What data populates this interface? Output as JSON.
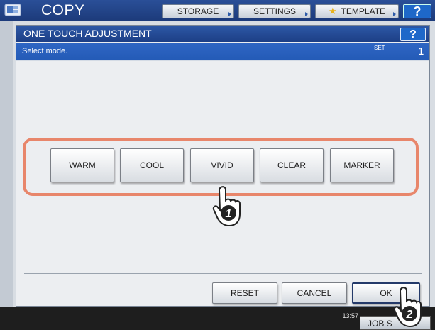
{
  "app": {
    "title": "COPY"
  },
  "top_tabs": [
    {
      "label": "STORAGE"
    },
    {
      "label": "SETTINGS"
    },
    {
      "label": "TEMPLATE"
    }
  ],
  "top_help": "?",
  "dialog": {
    "title": "ONE TOUCH ADJUSTMENT",
    "help": "?",
    "message": "Select mode.",
    "set_label": "SET",
    "set_count": "1",
    "modes": [
      "WARM",
      "COOL",
      "VIVID",
      "CLEAR",
      "MARKER"
    ],
    "buttons": {
      "reset": "RESET",
      "cancel": "CANCEL",
      "ok": "OK"
    }
  },
  "status": {
    "time": "13:57",
    "job_status": "JOB S"
  },
  "callouts": [
    "1",
    "2"
  ],
  "colors": {
    "header_blue": "#1d3f86",
    "highlight": "#e8866b",
    "help_blue": "#1e68c9"
  }
}
